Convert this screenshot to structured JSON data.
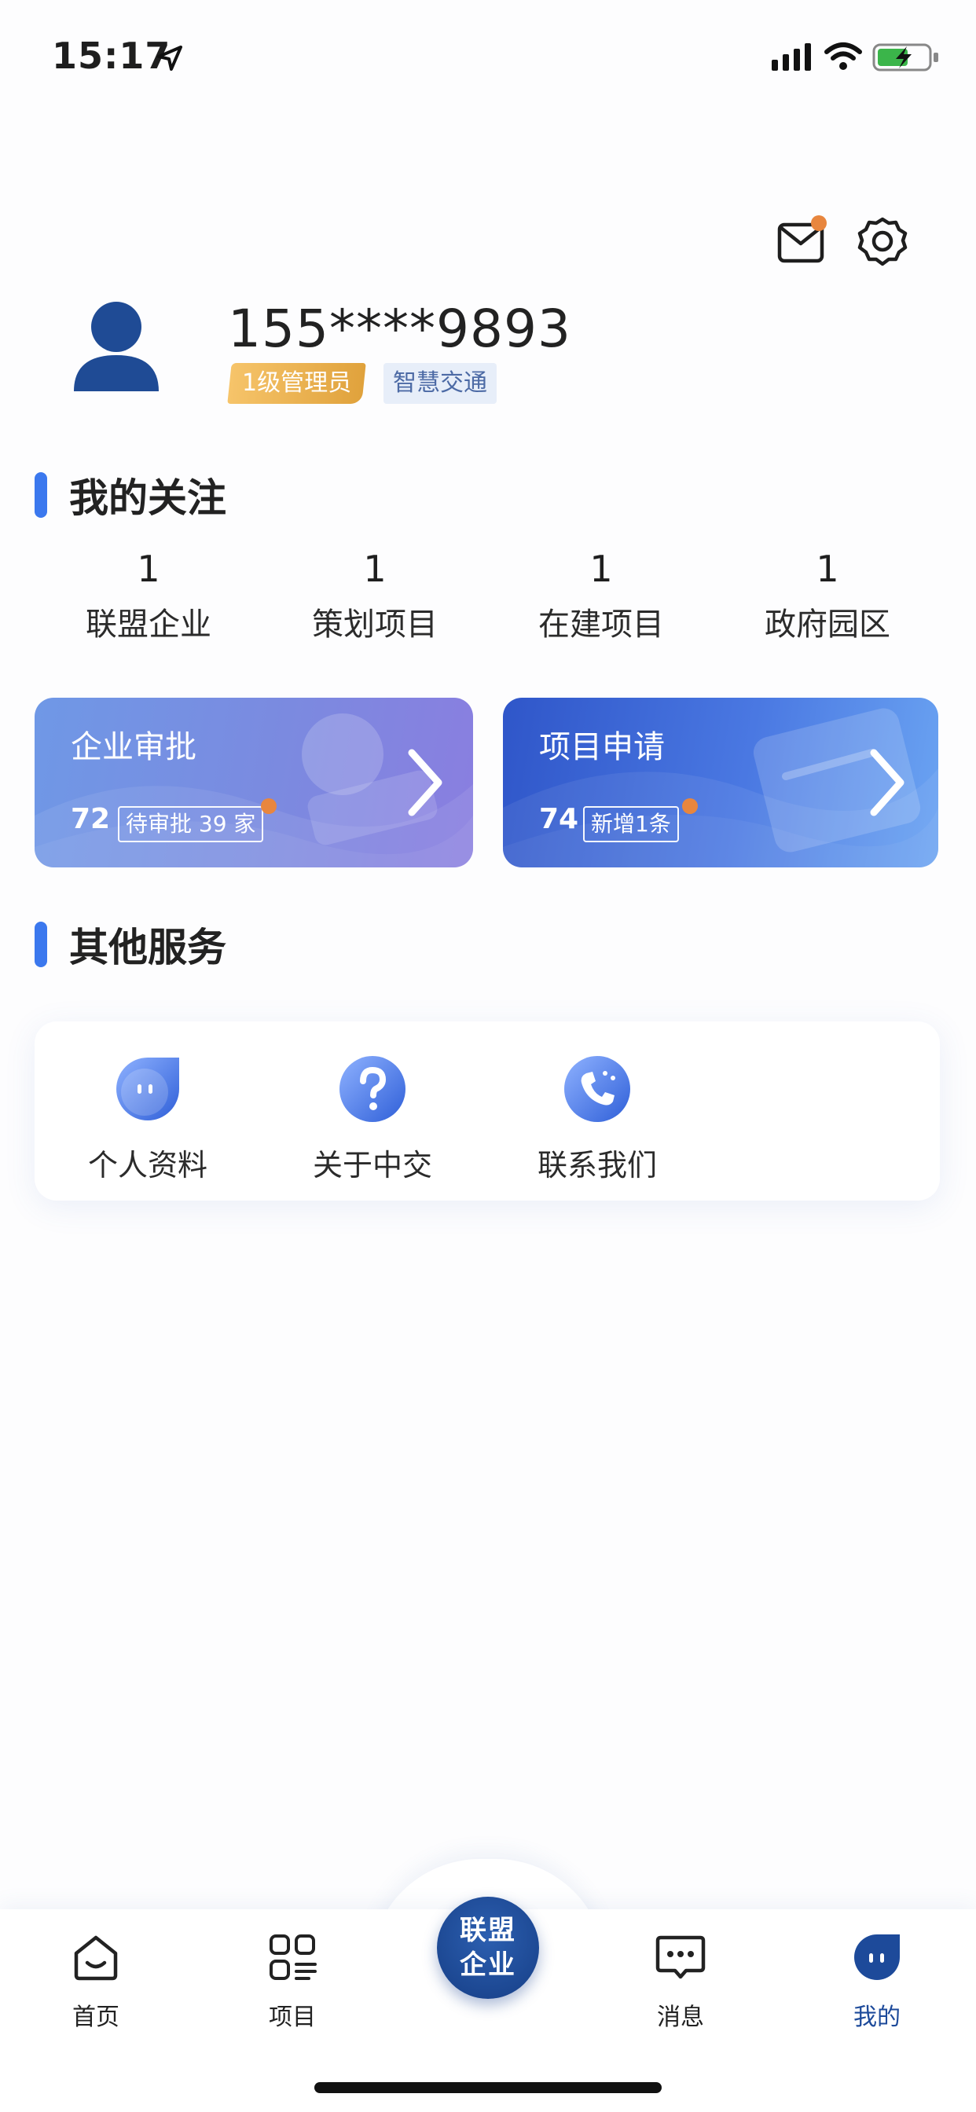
{
  "status_bar": {
    "time": "15:17"
  },
  "header": {
    "has_unread_mail": true
  },
  "profile": {
    "phone": "155****9893",
    "level_badge": "1级管理员",
    "org_badge": "智慧交通"
  },
  "follow_section": {
    "title": "我的关注",
    "stats": [
      {
        "value": "1",
        "label": "联盟企业"
      },
      {
        "value": "1",
        "label": "策划项目"
      },
      {
        "value": "1",
        "label": "在建项目"
      },
      {
        "value": "1",
        "label": "政府园区"
      }
    ]
  },
  "cards": [
    {
      "title": "企业审批",
      "count": "72",
      "tag": "待审批 39 家"
    },
    {
      "title": "项目申请",
      "count": "74",
      "tag": "新增1条"
    }
  ],
  "other_section": {
    "title": "其他服务",
    "items": [
      {
        "label": "个人资料",
        "icon": "profile-icon"
      },
      {
        "label": "关于中交",
        "icon": "question-icon"
      },
      {
        "label": "联系我们",
        "icon": "phone-icon"
      }
    ]
  },
  "tabbar": {
    "items": [
      {
        "label": "首页",
        "icon": "home-icon"
      },
      {
        "label": "项目",
        "icon": "project-icon"
      },
      {
        "label": "消息",
        "icon": "message-icon"
      },
      {
        "label": "我的",
        "icon": "mine-icon",
        "active": true
      }
    ],
    "center": {
      "label": "联盟企业"
    }
  },
  "colors": {
    "accent": "#3b78ee",
    "brand_dark": "#1d4a9a",
    "notify_dot": "#e8863e"
  }
}
